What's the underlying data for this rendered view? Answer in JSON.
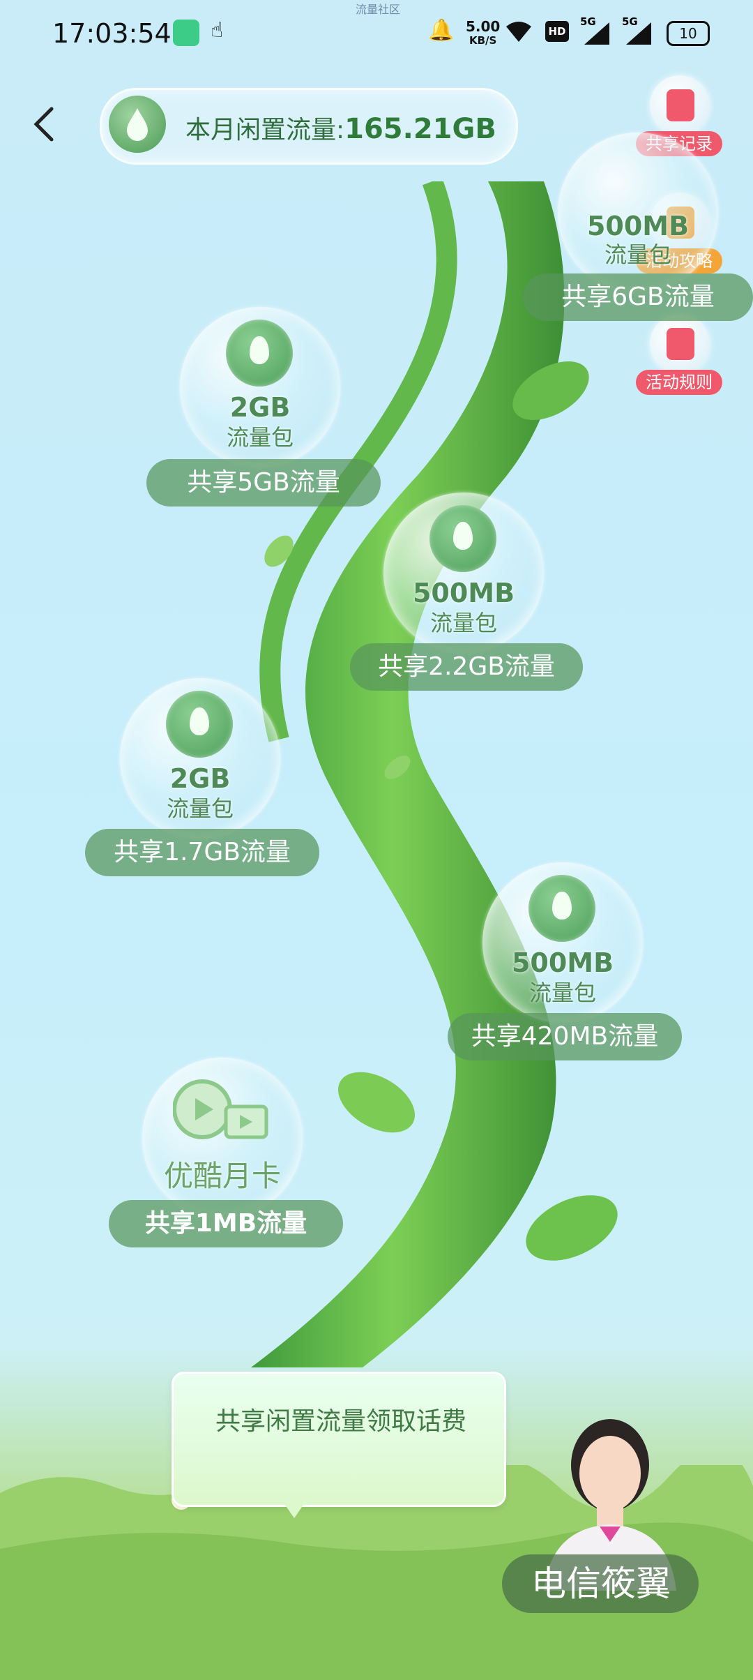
{
  "status_bar": {
    "time": "17:03:54",
    "app_label": "流量社区",
    "net_speed_value": "5.00",
    "net_speed_unit": "KB/S",
    "hd_label": "HD",
    "sim1": "5G",
    "sim2": "5G",
    "battery": "10"
  },
  "header": {
    "quota_label": "本月闲置流量:",
    "quota_value": "165.21GB"
  },
  "side_buttons": [
    {
      "label": "共享记录",
      "color": "#f0596b"
    },
    {
      "label": "活动攻略",
      "color": "#f4a53a"
    },
    {
      "label": "活动规则",
      "color": "#f0596b"
    }
  ],
  "rewards": [
    {
      "amount": "500MB",
      "unit": "流量包",
      "share": "共享6GB流量"
    },
    {
      "amount": "2GB",
      "unit": "流量包",
      "share": "共享5GB流量"
    },
    {
      "amount": "500MB",
      "unit": "流量包",
      "share": "共享2.2GB流量"
    },
    {
      "amount": "2GB",
      "unit": "流量包",
      "share": "共享1.7GB流量"
    },
    {
      "amount": "500MB",
      "unit": "流量包",
      "share": "共享420MB流量"
    },
    {
      "amount": "优酷月卡",
      "unit": "",
      "share": "共享1MB流量"
    }
  ],
  "tooltip": {
    "text": "共享闲置流量领取话费"
  },
  "assistant": {
    "name": "电信筱翼"
  }
}
